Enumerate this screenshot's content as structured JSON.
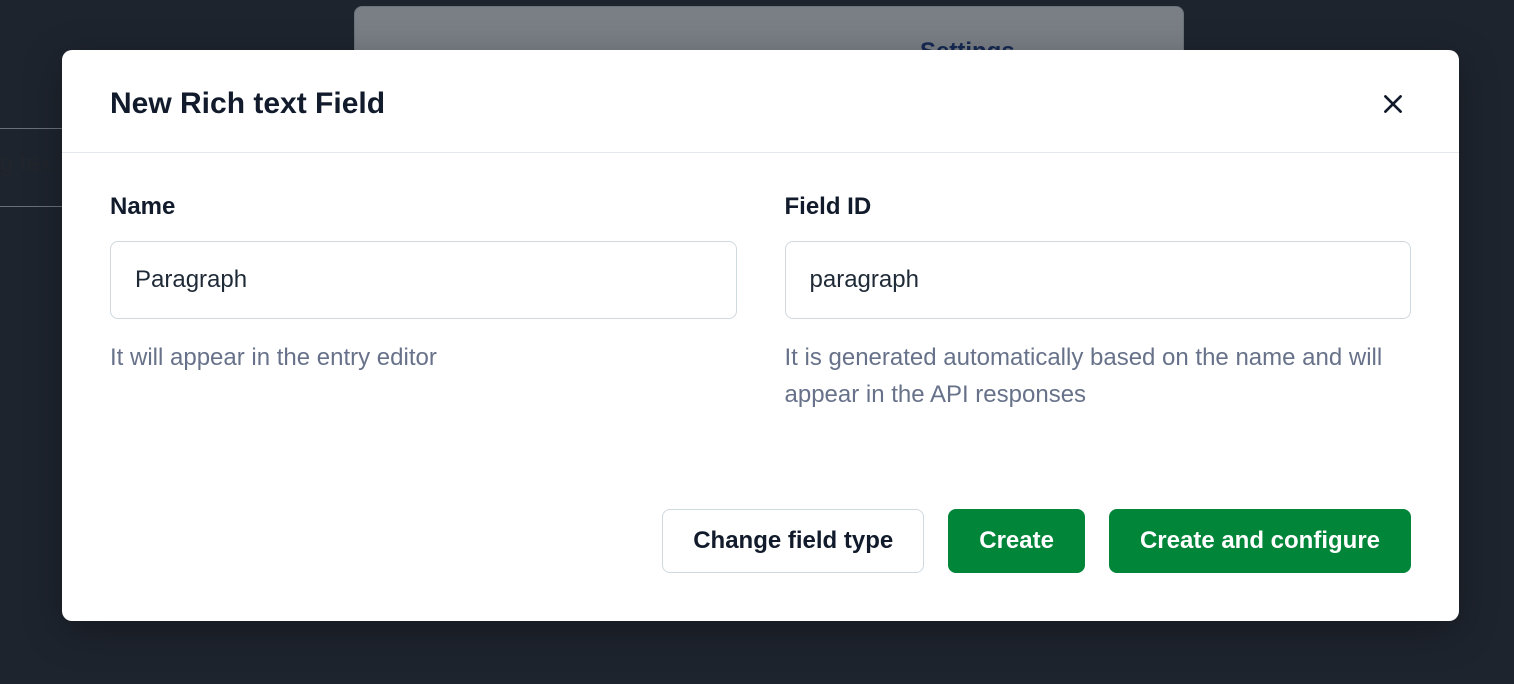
{
  "background": {
    "settings_label": "Settings",
    "partial_text": "g tex"
  },
  "modal": {
    "title": "New Rich text Field",
    "fields": {
      "name": {
        "label": "Name",
        "value": "Paragraph",
        "help": "It will appear in the entry editor"
      },
      "field_id": {
        "label": "Field ID",
        "value": "paragraph",
        "help": "It is generated automatically based on the name and will appear in the API responses"
      }
    },
    "buttons": {
      "change_type": "Change field type",
      "create": "Create",
      "create_configure": "Create and configure"
    }
  }
}
